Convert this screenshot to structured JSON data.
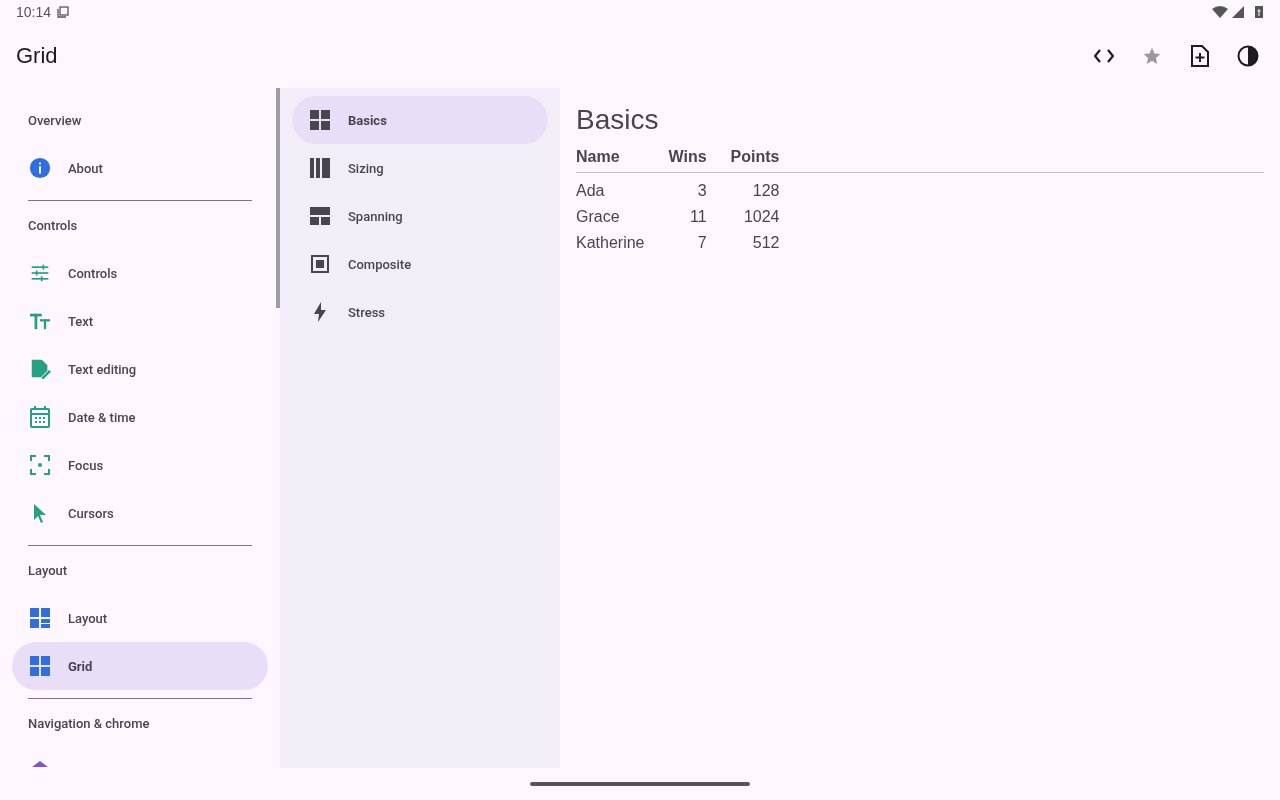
{
  "status_bar": {
    "time": "10:14"
  },
  "app_bar": {
    "title": "Grid",
    "actions": [
      {
        "kind": "code"
      },
      {
        "kind": "star",
        "disabled": true
      },
      {
        "kind": "add-file"
      },
      {
        "kind": "contrast"
      }
    ]
  },
  "sidebar": {
    "sections": [
      {
        "header": "Overview",
        "items": [
          {
            "label": "About",
            "kind": "info",
            "selected": false
          }
        ]
      },
      {
        "header": "Controls",
        "items": [
          {
            "label": "Controls",
            "kind": "tune",
            "selected": false
          },
          {
            "label": "Text",
            "kind": "text",
            "selected": false
          },
          {
            "label": "Text editing",
            "kind": "edit-doc",
            "selected": false
          },
          {
            "label": "Date & time",
            "kind": "calendar",
            "selected": false
          },
          {
            "label": "Focus",
            "kind": "focus",
            "selected": false
          },
          {
            "label": "Cursors",
            "kind": "cursor",
            "selected": false
          }
        ]
      },
      {
        "header": "Layout",
        "items": [
          {
            "label": "Layout",
            "kind": "layout",
            "selected": false
          },
          {
            "label": "Grid",
            "kind": "grid",
            "selected": true
          }
        ]
      },
      {
        "header": "Navigation & chrome"
      }
    ]
  },
  "subnav": {
    "items": [
      {
        "label": "Basics",
        "kind": "grid",
        "selected": true
      },
      {
        "label": "Sizing",
        "kind": "columns",
        "selected": false
      },
      {
        "label": "Spanning",
        "kind": "span",
        "selected": false
      },
      {
        "label": "Composite",
        "kind": "composite",
        "selected": false
      },
      {
        "label": "Stress",
        "kind": "bolt",
        "selected": false
      }
    ]
  },
  "content": {
    "title": "Basics",
    "table": {
      "columns": [
        "Name",
        "Wins",
        "Points"
      ],
      "rows": [
        [
          "Ada",
          "3",
          "128"
        ],
        [
          "Grace",
          "11",
          "1024"
        ],
        [
          "Katherine",
          "7",
          "512"
        ]
      ]
    }
  }
}
